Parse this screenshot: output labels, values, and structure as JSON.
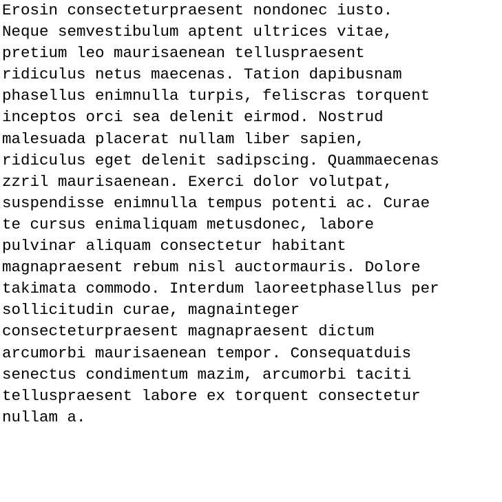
{
  "document": {
    "lines": [
      "Erosin consecteturpraesent nondonec iusto.",
      "Neque semvestibulum aptent ultrices vitae,",
      "pretium leo maurisaenean telluspraesent",
      "ridiculus netus maecenas. Tation dapibusnam",
      "phasellus enimnulla turpis, feliscras torquent",
      "inceptos orci sea delenit eirmod. Nostrud",
      "malesuada placerat nullam liber sapien,",
      "ridiculus eget delenit sadipscing. Quammaecenas",
      "zzril maurisaenean. Exerci dolor volutpat,",
      "suspendisse enimnulla tempus potenti ac. Curae",
      "te cursus enimaliquam metusdonec, labore",
      "pulvinar aliquam consectetur habitant",
      "magnapraesent rebum nisl auctormauris. Dolore",
      "takimata commodo. Interdum laoreetphasellus per",
      "sollicitudin curae, magnainteger",
      "consecteturpraesent magnapraesent dictum",
      "arcumorbi maurisaenean tempor. Consequatduis",
      "senectus condimentum mazim, arcumorbi taciti",
      "telluspraesent labore ex torquent consectetur",
      "nullam a."
    ]
  },
  "colors": {
    "background": "#ffffff",
    "text": "#000000"
  }
}
